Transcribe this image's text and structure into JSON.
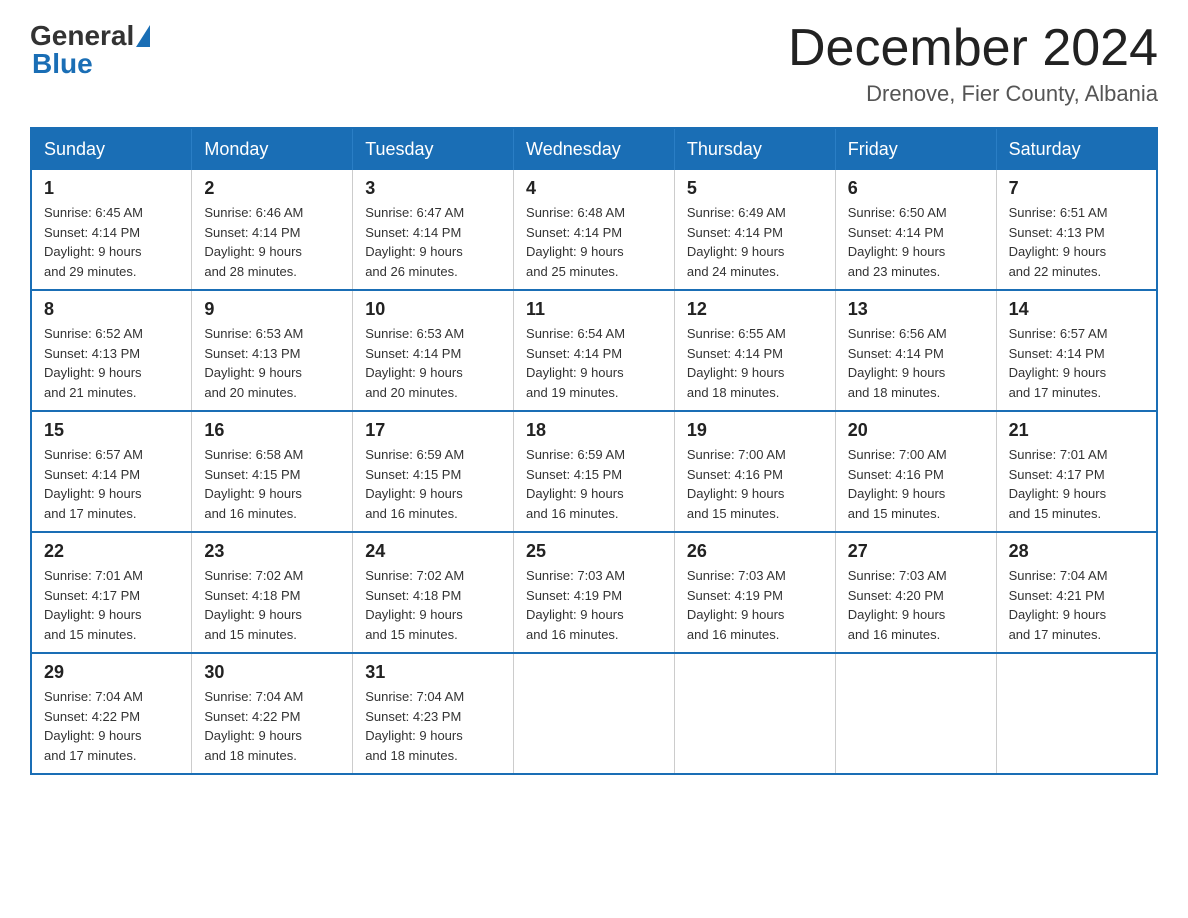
{
  "logo": {
    "general": "General",
    "blue": "Blue"
  },
  "header": {
    "month_title": "December 2024",
    "location": "Drenove, Fier County, Albania"
  },
  "days_of_week": [
    "Sunday",
    "Monday",
    "Tuesday",
    "Wednesday",
    "Thursday",
    "Friday",
    "Saturday"
  ],
  "weeks": [
    [
      {
        "day": "1",
        "sunrise": "6:45 AM",
        "sunset": "4:14 PM",
        "daylight": "9 hours and 29 minutes."
      },
      {
        "day": "2",
        "sunrise": "6:46 AM",
        "sunset": "4:14 PM",
        "daylight": "9 hours and 28 minutes."
      },
      {
        "day": "3",
        "sunrise": "6:47 AM",
        "sunset": "4:14 PM",
        "daylight": "9 hours and 26 minutes."
      },
      {
        "day": "4",
        "sunrise": "6:48 AM",
        "sunset": "4:14 PM",
        "daylight": "9 hours and 25 minutes."
      },
      {
        "day": "5",
        "sunrise": "6:49 AM",
        "sunset": "4:14 PM",
        "daylight": "9 hours and 24 minutes."
      },
      {
        "day": "6",
        "sunrise": "6:50 AM",
        "sunset": "4:14 PM",
        "daylight": "9 hours and 23 minutes."
      },
      {
        "day": "7",
        "sunrise": "6:51 AM",
        "sunset": "4:13 PM",
        "daylight": "9 hours and 22 minutes."
      }
    ],
    [
      {
        "day": "8",
        "sunrise": "6:52 AM",
        "sunset": "4:13 PM",
        "daylight": "9 hours and 21 minutes."
      },
      {
        "day": "9",
        "sunrise": "6:53 AM",
        "sunset": "4:13 PM",
        "daylight": "9 hours and 20 minutes."
      },
      {
        "day": "10",
        "sunrise": "6:53 AM",
        "sunset": "4:14 PM",
        "daylight": "9 hours and 20 minutes."
      },
      {
        "day": "11",
        "sunrise": "6:54 AM",
        "sunset": "4:14 PM",
        "daylight": "9 hours and 19 minutes."
      },
      {
        "day": "12",
        "sunrise": "6:55 AM",
        "sunset": "4:14 PM",
        "daylight": "9 hours and 18 minutes."
      },
      {
        "day": "13",
        "sunrise": "6:56 AM",
        "sunset": "4:14 PM",
        "daylight": "9 hours and 18 minutes."
      },
      {
        "day": "14",
        "sunrise": "6:57 AM",
        "sunset": "4:14 PM",
        "daylight": "9 hours and 17 minutes."
      }
    ],
    [
      {
        "day": "15",
        "sunrise": "6:57 AM",
        "sunset": "4:14 PM",
        "daylight": "9 hours and 17 minutes."
      },
      {
        "day": "16",
        "sunrise": "6:58 AM",
        "sunset": "4:15 PM",
        "daylight": "9 hours and 16 minutes."
      },
      {
        "day": "17",
        "sunrise": "6:59 AM",
        "sunset": "4:15 PM",
        "daylight": "9 hours and 16 minutes."
      },
      {
        "day": "18",
        "sunrise": "6:59 AM",
        "sunset": "4:15 PM",
        "daylight": "9 hours and 16 minutes."
      },
      {
        "day": "19",
        "sunrise": "7:00 AM",
        "sunset": "4:16 PM",
        "daylight": "9 hours and 15 minutes."
      },
      {
        "day": "20",
        "sunrise": "7:00 AM",
        "sunset": "4:16 PM",
        "daylight": "9 hours and 15 minutes."
      },
      {
        "day": "21",
        "sunrise": "7:01 AM",
        "sunset": "4:17 PM",
        "daylight": "9 hours and 15 minutes."
      }
    ],
    [
      {
        "day": "22",
        "sunrise": "7:01 AM",
        "sunset": "4:17 PM",
        "daylight": "9 hours and 15 minutes."
      },
      {
        "day": "23",
        "sunrise": "7:02 AM",
        "sunset": "4:18 PM",
        "daylight": "9 hours and 15 minutes."
      },
      {
        "day": "24",
        "sunrise": "7:02 AM",
        "sunset": "4:18 PM",
        "daylight": "9 hours and 15 minutes."
      },
      {
        "day": "25",
        "sunrise": "7:03 AM",
        "sunset": "4:19 PM",
        "daylight": "9 hours and 16 minutes."
      },
      {
        "day": "26",
        "sunrise": "7:03 AM",
        "sunset": "4:19 PM",
        "daylight": "9 hours and 16 minutes."
      },
      {
        "day": "27",
        "sunrise": "7:03 AM",
        "sunset": "4:20 PM",
        "daylight": "9 hours and 16 minutes."
      },
      {
        "day": "28",
        "sunrise": "7:04 AM",
        "sunset": "4:21 PM",
        "daylight": "9 hours and 17 minutes."
      }
    ],
    [
      {
        "day": "29",
        "sunrise": "7:04 AM",
        "sunset": "4:22 PM",
        "daylight": "9 hours and 17 minutes."
      },
      {
        "day": "30",
        "sunrise": "7:04 AM",
        "sunset": "4:22 PM",
        "daylight": "9 hours and 18 minutes."
      },
      {
        "day": "31",
        "sunrise": "7:04 AM",
        "sunset": "4:23 PM",
        "daylight": "9 hours and 18 minutes."
      },
      null,
      null,
      null,
      null
    ]
  ],
  "labels": {
    "sunrise": "Sunrise:",
    "sunset": "Sunset:",
    "daylight": "Daylight:"
  }
}
